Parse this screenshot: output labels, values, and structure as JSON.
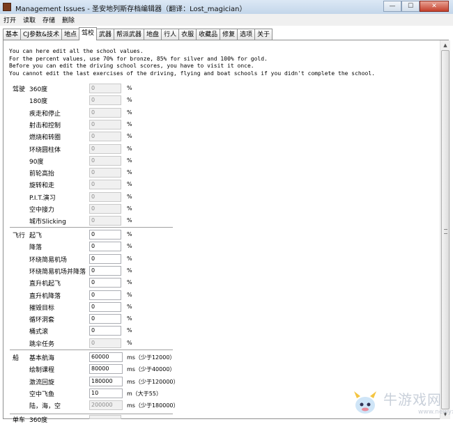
{
  "window": {
    "title": "Management Issues - 圣安地列斯存档编辑器（翻译：Lost_magician）",
    "buttons": [
      "—",
      "☐",
      "✕"
    ]
  },
  "menu": [
    "打开",
    "读取",
    "存储",
    "删除"
  ],
  "tabs": [
    {
      "label": "基本"
    },
    {
      "label": "CJ参数&技术"
    },
    {
      "label": "地点"
    },
    {
      "label": "驾校",
      "active": true
    },
    {
      "label": "武器"
    },
    {
      "label": "帮派武器"
    },
    {
      "label": "地盘"
    },
    {
      "label": "行人"
    },
    {
      "label": "衣服"
    },
    {
      "label": "收藏品"
    },
    {
      "label": "修复"
    },
    {
      "label": "选项"
    },
    {
      "label": "关于"
    }
  ],
  "info_lines": [
    "You can here edit all the school values.",
    "For the percent values, use 70% for bronze, 85% for silver and 100% for gold.",
    "Before you can edit the driving school scores, you have to visit it once.",
    "You cannot edit the last exercises of the driving, flying and boat schools if you didn't complete the school."
  ],
  "driving": {
    "section": "驾驶",
    "rows": [
      {
        "label": "360度",
        "value": "0",
        "unit": "%",
        "disabled": true
      },
      {
        "label": "180度",
        "value": "0",
        "unit": "%",
        "disabled": true
      },
      {
        "label": "疾走和停止",
        "value": "0",
        "unit": "%",
        "disabled": true
      },
      {
        "label": "射击和控制",
        "value": "0",
        "unit": "%",
        "disabled": true
      },
      {
        "label": "燃烧和转圈",
        "value": "0",
        "unit": "%",
        "disabled": true
      },
      {
        "label": "环绕圆柱体",
        "value": "0",
        "unit": "%",
        "disabled": true
      },
      {
        "label": "90度",
        "value": "0",
        "unit": "%",
        "disabled": true
      },
      {
        "label": "前轮高抬",
        "value": "0",
        "unit": "%",
        "disabled": true
      },
      {
        "label": "旋转和走",
        "value": "0",
        "unit": "%",
        "disabled": true
      },
      {
        "label": "P.I.T.演习",
        "value": "0",
        "unit": "%",
        "disabled": true
      },
      {
        "label": "空中接力",
        "value": "0",
        "unit": "%",
        "disabled": true
      },
      {
        "label": "城市Slicking",
        "value": "0",
        "unit": "%",
        "disabled": true
      }
    ]
  },
  "flying": {
    "section": "飞行",
    "rows": [
      {
        "label": "起飞",
        "value": "0",
        "unit": "%",
        "disabled": false
      },
      {
        "label": "降落",
        "value": "0",
        "unit": "%",
        "disabled": false
      },
      {
        "label": "环绕简易机场",
        "value": "0",
        "unit": "%",
        "disabled": false
      },
      {
        "label": "环绕简易机场并降落",
        "value": "0",
        "unit": "%",
        "disabled": false
      },
      {
        "label": "直升机起飞",
        "value": "0",
        "unit": "%",
        "disabled": false
      },
      {
        "label": "直升机降落",
        "value": "0",
        "unit": "%",
        "disabled": false
      },
      {
        "label": "摧毁目标",
        "value": "0",
        "unit": "%",
        "disabled": false
      },
      {
        "label": "循环洞套",
        "value": "0",
        "unit": "%",
        "disabled": false
      },
      {
        "label": "桶式滚",
        "value": "0",
        "unit": "%",
        "disabled": false
      },
      {
        "label": "跳伞任务",
        "value": "0",
        "unit": "%",
        "disabled": true
      }
    ]
  },
  "boat": {
    "section": "船",
    "rows": [
      {
        "label": "基本航海",
        "value": "60000",
        "unit": "ms（少于12000）",
        "disabled": false
      },
      {
        "label": "绘制课程",
        "value": "80000",
        "unit": "ms（少于40000）",
        "disabled": false
      },
      {
        "label": "激流回旋",
        "value": "180000",
        "unit": "ms（少于120000）",
        "disabled": false
      },
      {
        "label": "空中飞鱼",
        "value": "10",
        "unit": "m（大于55）",
        "disabled": false
      },
      {
        "label": "陆，海，空",
        "value": "200000",
        "unit": "ms（少于180000）",
        "disabled": true
      }
    ]
  },
  "partial_row": {
    "section": "单车",
    "label": "360度"
  },
  "watermark": {
    "text": "牛游戏网",
    "url": "www.newyx.net"
  }
}
